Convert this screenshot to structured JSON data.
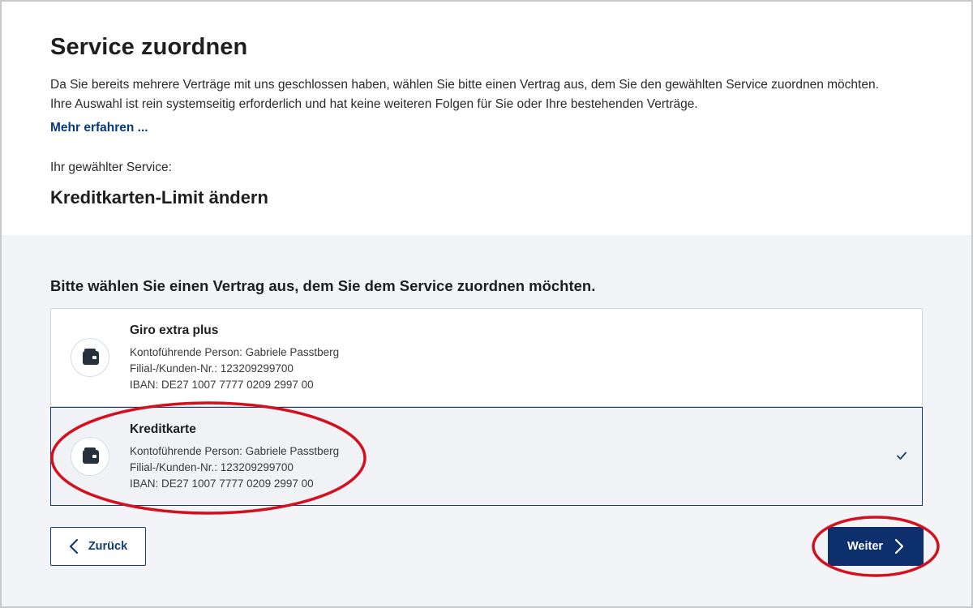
{
  "header": {
    "title": "Service zuordnen",
    "intro": "Da Sie bereits mehrere Verträge mit uns geschlossen haben, wählen Sie bitte einen Vertrag aus, dem Sie den gewählten Service zuordnen möchten. Ihre Auswahl ist rein systemseitig erforderlich und hat keine weiteren Folgen für Sie oder Ihre bestehenden Verträge.",
    "more_link": "Mehr erfahren ..."
  },
  "service": {
    "label": "Ihr gewählter Service:",
    "name": "Kreditkarten-Limit ändern"
  },
  "selection": {
    "heading": "Bitte wählen Sie einen Vertrag aus, dem Sie dem Service zuordnen möchten.",
    "options": [
      {
        "title": "Giro extra plus",
        "holder": "Kontoführende Person: Gabriele Passtberg",
        "customer_no": "Filial-/Kunden-Nr.: 123209299700",
        "iban": "IBAN: DE27 1007 7777 0209 2997 00",
        "icon": "wallet-icon",
        "selected": false
      },
      {
        "title": "Kreditkarte",
        "holder": "Kontoführende Person: Gabriele Passtberg",
        "customer_no": "Filial-/Kunden-Nr.: 123209299700",
        "iban": "IBAN: DE27 1007 7777 0209 2997 00",
        "icon": "wallet-icon",
        "selected": true
      }
    ]
  },
  "actions": {
    "back_label": "Zurück",
    "next_label": "Weiter"
  },
  "colors": {
    "primary": "#0d2f6b",
    "link": "#0a3a7c",
    "annotation": "#d4101e",
    "section_bg": "#f2f4f7"
  }
}
